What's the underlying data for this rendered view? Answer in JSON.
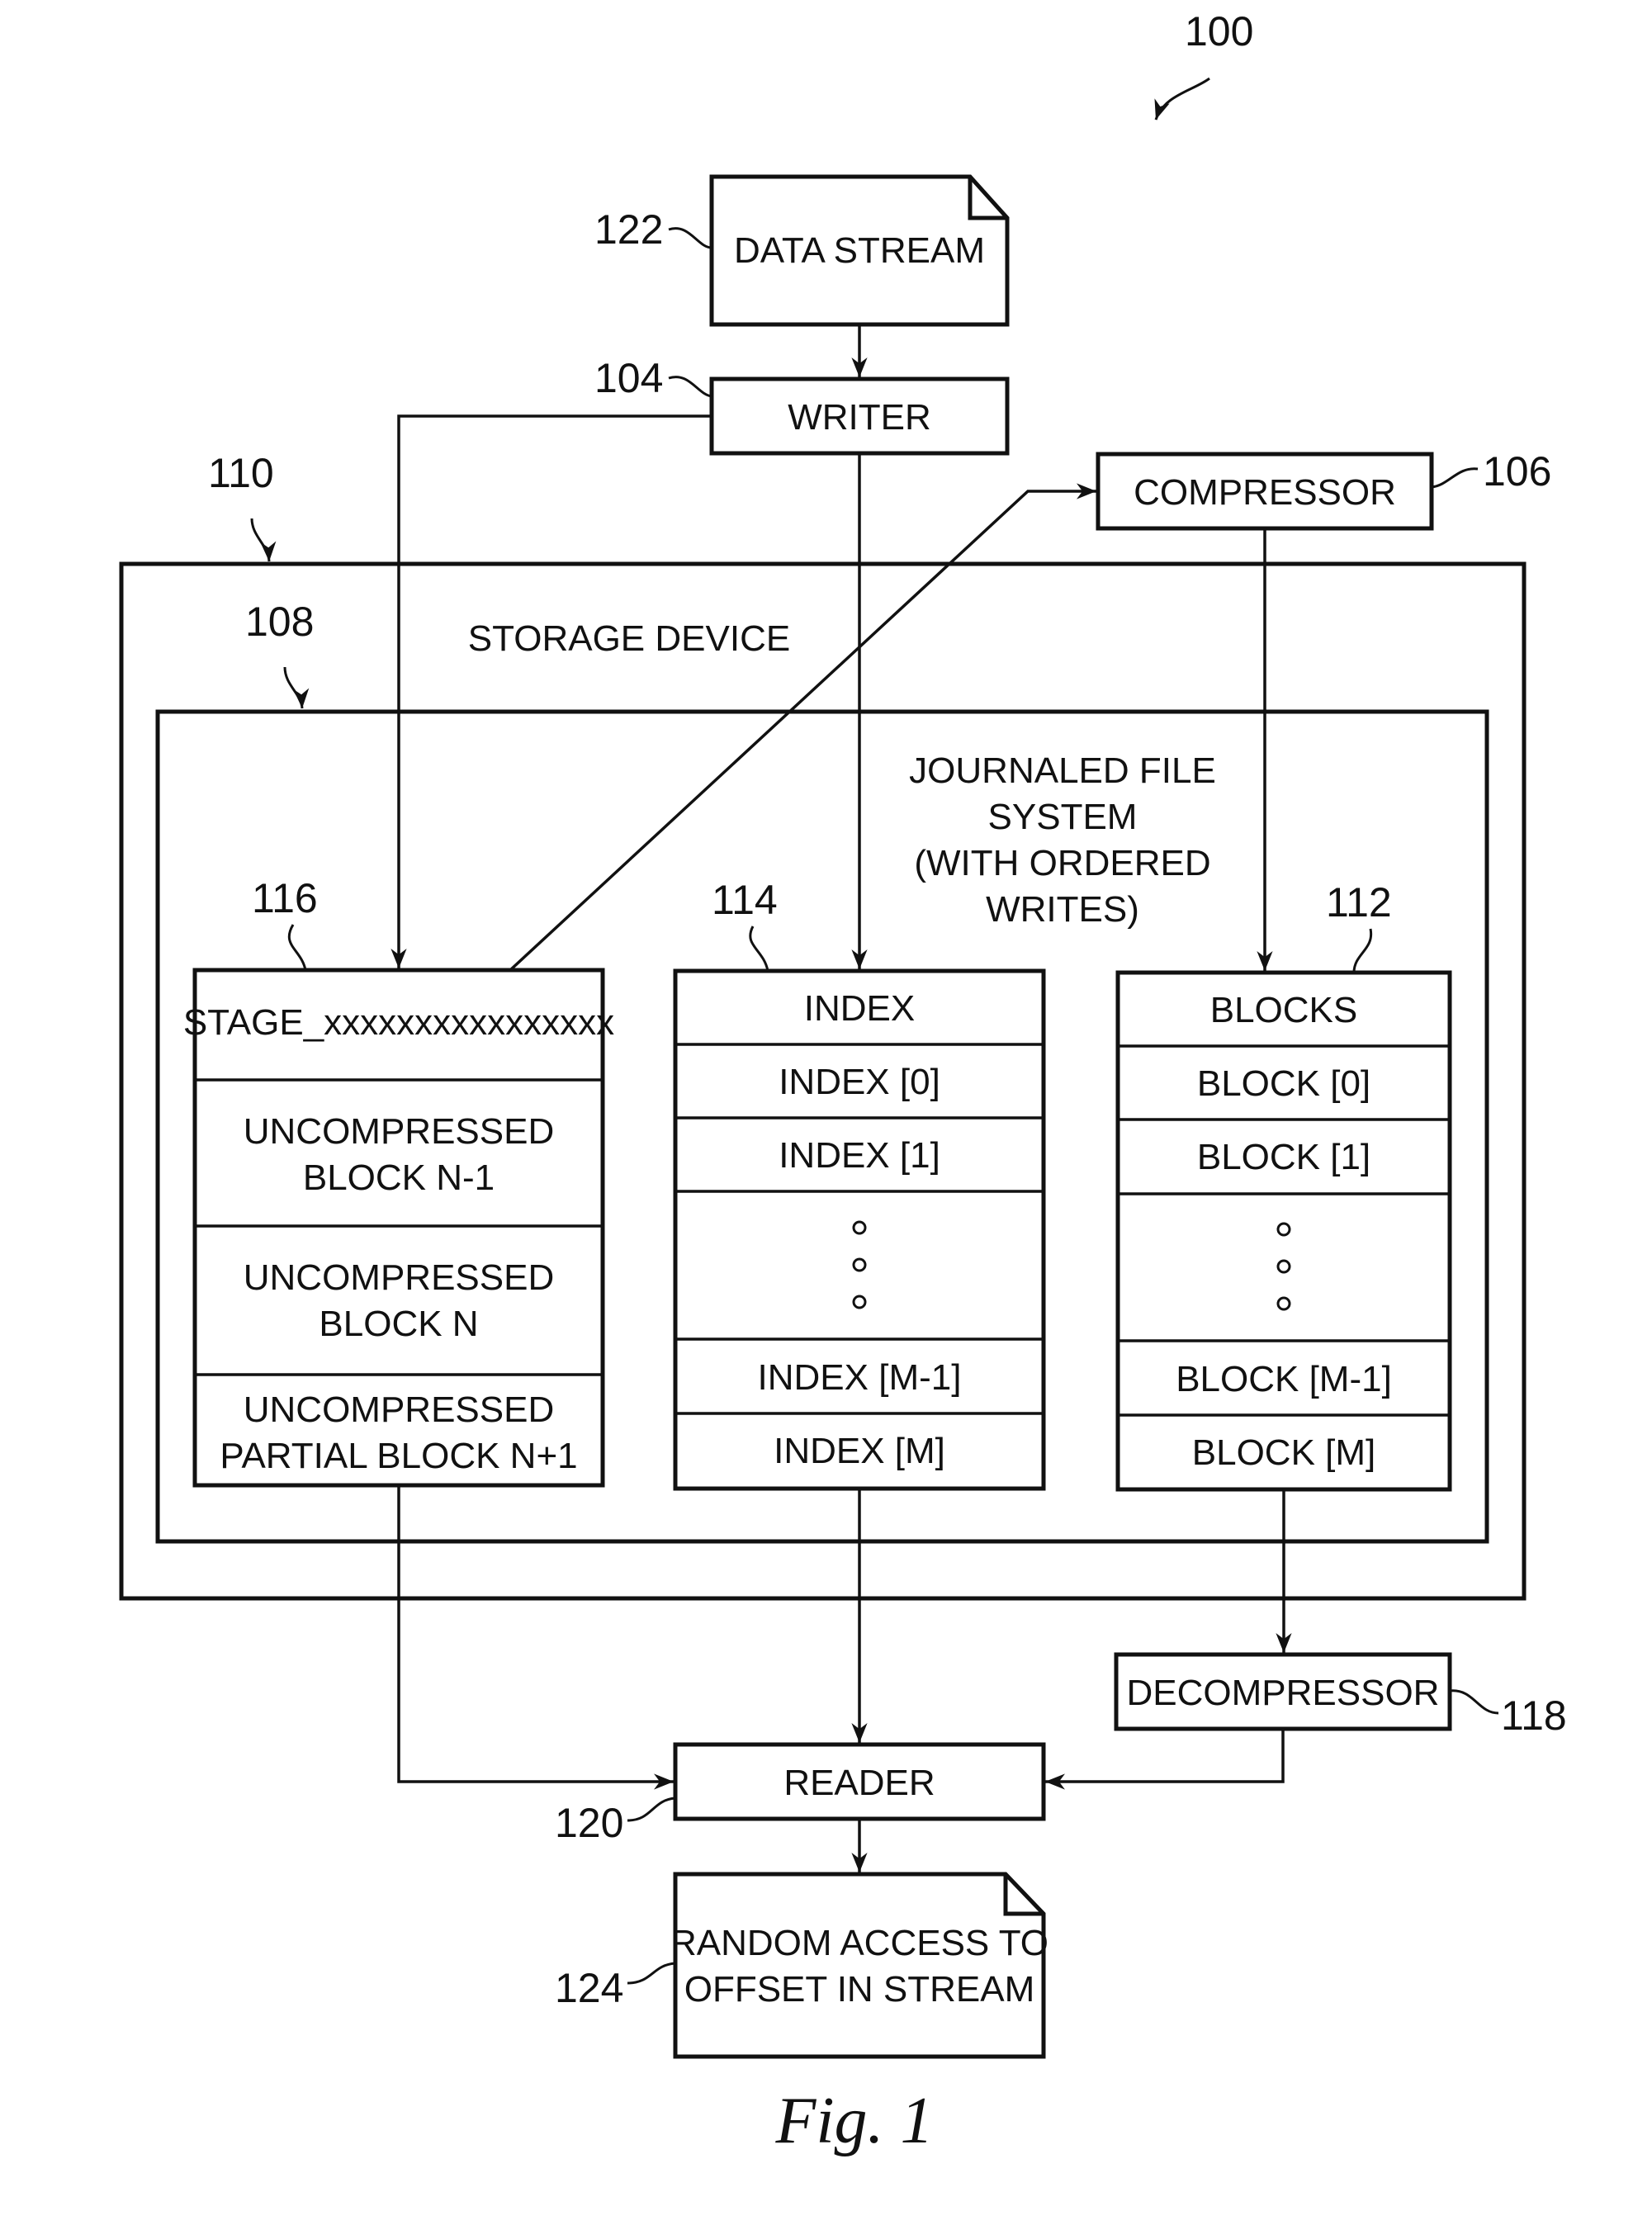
{
  "figure": {
    "ref": "100",
    "caption": "Fig. 1"
  },
  "data_stream": {
    "ref": "122",
    "label": "DATA STREAM"
  },
  "writer": {
    "ref": "104",
    "label": "WRITER"
  },
  "compressor": {
    "ref": "106",
    "label": "COMPRESSOR"
  },
  "storage_device": {
    "ref": "110",
    "label": "STORAGE DEVICE"
  },
  "journaled_fs": {
    "ref": "108",
    "label_lines": [
      "JOURNALED FILE",
      "SYSTEM",
      "(WITH ORDERED",
      "WRITES)"
    ]
  },
  "stage": {
    "ref": "116",
    "header": "STAGE_xxxxxxxxxxxxxxxx",
    "rows": [
      [
        "UNCOMPRESSED",
        "BLOCK N-1"
      ],
      [
        "UNCOMPRESSED",
        "BLOCK N"
      ],
      [
        "UNCOMPRESSED",
        "PARTIAL BLOCK N+1"
      ]
    ]
  },
  "index": {
    "ref": "114",
    "header": "INDEX",
    "rows": [
      "INDEX [0]",
      "INDEX [1]",
      "ellipsis",
      "INDEX [M-1]",
      "INDEX [M]"
    ]
  },
  "blocks": {
    "ref": "112",
    "header": "BLOCKS",
    "rows": [
      "BLOCK [0]",
      "BLOCK [1]",
      "ellipsis",
      "BLOCK [M-1]",
      "BLOCK [M]"
    ]
  },
  "decompressor": {
    "ref": "118",
    "label": "DECOMPRESSOR"
  },
  "reader": {
    "ref": "120",
    "label": "READER"
  },
  "random_access": {
    "ref": "124",
    "label_lines": [
      "RANDOM ACCESS TO",
      "OFFSET IN STREAM"
    ]
  }
}
